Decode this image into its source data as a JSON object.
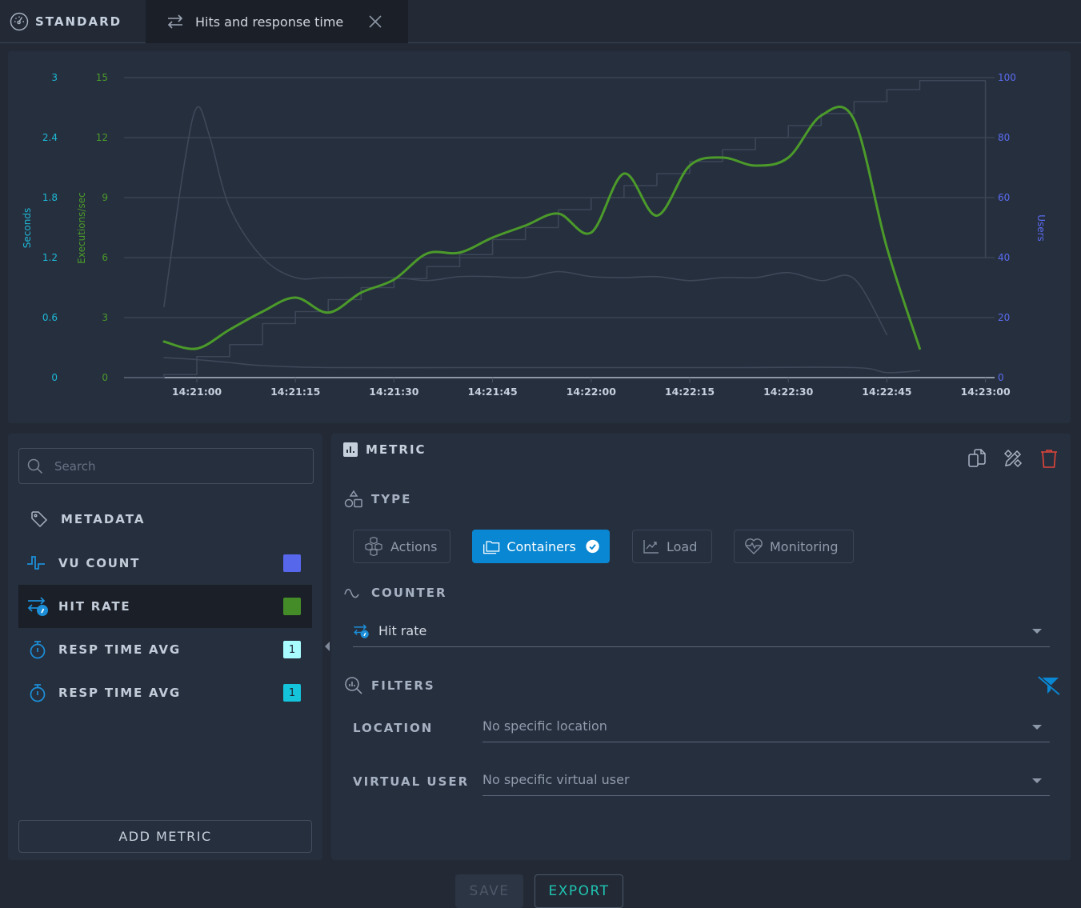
{
  "tabs": {
    "standard": {
      "label": "STANDARD",
      "icon": "dashboard-gauge-icon"
    },
    "active": {
      "label": "Hits and response time",
      "icon": "swap-arrows-icon",
      "close_icon": "close-icon"
    }
  },
  "colors": {
    "seconds_axis": "#1eb8d6",
    "exec_axis": "#4b9a2a",
    "users_axis": "#5a6cf0",
    "hit_rate_line": "#4b9a2a",
    "vu_line": "#3c4656",
    "resp_line": "#3e4858",
    "accent": "#0a87d2",
    "delete": "#e0453a",
    "export": "#1fc3b0"
  },
  "chart_data": {
    "type": "line",
    "title": "",
    "x_ticks": [
      "14:21:00",
      "14:21:15",
      "14:21:30",
      "14:21:45",
      "14:22:00",
      "14:22:15",
      "14:22:30",
      "14:22:45",
      "14:23:00"
    ],
    "x_unit": "seconds since 14:21:00",
    "x_range": [
      -11,
      120
    ],
    "axes": {
      "seconds": {
        "label": "Seconds",
        "side": "left-outer",
        "range": [
          0,
          3
        ],
        "ticks": [
          "0",
          "0.6",
          "1.2",
          "1.8",
          "2.4",
          "3"
        ]
      },
      "executions": {
        "label": "Executions/sec",
        "side": "left-inner",
        "range": [
          0,
          15
        ],
        "ticks": [
          "0",
          "3",
          "6",
          "9",
          "12",
          "15"
        ]
      },
      "users": {
        "label": "Users",
        "side": "right",
        "range": [
          0,
          100
        ],
        "ticks": [
          "0",
          "20",
          "40",
          "60",
          "80",
          "100"
        ]
      }
    },
    "grid": true,
    "series": [
      {
        "name": "Hit rate",
        "axis": "executions",
        "style": "smooth",
        "x": [
          -5,
          0,
          5,
          10,
          15,
          20,
          25,
          30,
          35,
          40,
          45,
          50,
          55,
          60,
          65,
          70,
          75,
          80,
          85,
          90,
          95,
          100,
          105,
          110
        ],
        "values": [
          1.8,
          1.45,
          2.4,
          3.3,
          4.0,
          3.25,
          4.25,
          4.9,
          6.2,
          6.25,
          7.0,
          7.6,
          8.2,
          7.25,
          10.2,
          8.1,
          10.6,
          11.0,
          10.6,
          11.0,
          13.1,
          12.9,
          6.5,
          1.45
        ]
      },
      {
        "name": "VU count",
        "axis": "users",
        "style": "step",
        "x": [
          -11,
          -5,
          0,
          5,
          10,
          15,
          20,
          25,
          30,
          35,
          40,
          45,
          50,
          55,
          60,
          65,
          70,
          75,
          80,
          85,
          90,
          95,
          100,
          105,
          110,
          115,
          120
        ],
        "values": [
          0,
          1,
          7,
          11,
          18,
          22,
          26,
          30,
          33,
          37,
          41,
          46,
          50,
          56,
          60,
          64,
          68,
          72,
          76,
          80,
          84,
          88,
          92,
          96,
          99,
          99,
          40
        ]
      },
      {
        "name": "Resp time avg (1)",
        "axis": "seconds",
        "style": "smooth",
        "x": [
          -5,
          -2,
          0,
          2,
          5,
          10,
          15,
          20,
          30,
          35,
          40,
          45,
          50,
          55,
          60,
          65,
          70,
          75,
          80,
          85,
          90,
          95,
          100,
          105
        ],
        "values": [
          0.71,
          2.1,
          2.7,
          2.4,
          1.7,
          1.2,
          1.0,
          1.0,
          1.0,
          0.97,
          1.01,
          1.01,
          1.0,
          1.06,
          1.01,
          1.0,
          1.01,
          0.97,
          1.0,
          1.0,
          1.05,
          0.97,
          0.99,
          0.43
        ]
      },
      {
        "name": "Resp time avg (2)",
        "axis": "seconds",
        "style": "smooth",
        "x": [
          -5,
          0,
          5,
          10,
          20,
          40,
          60,
          80,
          100,
          105,
          110
        ],
        "values": [
          0.2,
          0.18,
          0.15,
          0.12,
          0.1,
          0.1,
          0.1,
          0.1,
          0.1,
          0.05,
          0.07
        ]
      }
    ]
  },
  "left_panel": {
    "search": {
      "placeholder": "Search",
      "value": ""
    },
    "metadata_label": "METADATA",
    "metrics": [
      {
        "label": "VU COUNT",
        "icon": "vu-wave-icon",
        "swatch": "#5767ec",
        "badge": ""
      },
      {
        "label": "HIT RATE",
        "icon": "hit-rate-icon",
        "swatch": "#448c27",
        "badge": "",
        "selected": true
      },
      {
        "label": "RESP TIME AVG",
        "icon": "stopwatch-icon",
        "swatch": "#a8fbff",
        "badge": "1"
      },
      {
        "label": "RESP TIME AVG",
        "icon": "stopwatch-icon",
        "swatch": "#14c4da",
        "badge": "1"
      }
    ],
    "add_metric_label": "ADD METRIC"
  },
  "right_panel": {
    "metric_title": "METRIC",
    "actions": {
      "duplicate": "duplicate-icon",
      "edit": "edit-icon",
      "delete": "trash-icon"
    },
    "type_title": "TYPE",
    "types": [
      {
        "label": "Actions",
        "icon": "cubes-icon",
        "active": false
      },
      {
        "label": "Containers",
        "icon": "folders-icon",
        "active": true
      },
      {
        "label": "Load",
        "icon": "line-chart-icon",
        "active": false
      },
      {
        "label": "Monitoring",
        "icon": "heart-pulse-icon",
        "active": false
      }
    ],
    "counter_title": "COUNTER",
    "counter_value": "Hit rate",
    "filters_title": "FILTERS",
    "filters": [
      {
        "label": "LOCATION",
        "value": "No specific location"
      },
      {
        "label": "VIRTUAL USER",
        "value": "No specific virtual user"
      }
    ]
  },
  "footer": {
    "save_label": "SAVE",
    "export_label": "EXPORT",
    "save_disabled": true
  }
}
